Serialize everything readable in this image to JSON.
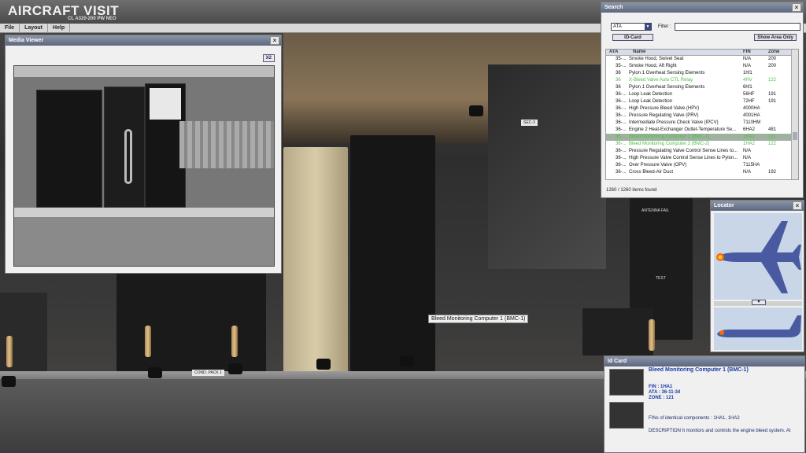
{
  "app": {
    "title": "AIRCRAFT VISIT",
    "subtitle": "CL A320-200 PW NEO"
  },
  "menu": [
    "File",
    "Layout",
    "Help"
  ],
  "scene": {
    "tooltip": "Bleed Monitoring Computer 1 (BMC-1)",
    "labels": {
      "antenna_fail": "ANTENNA FAIL",
      "test": "TEST",
      "cont_pack": "COND. PACK 1",
      "sec": "SEC-3"
    }
  },
  "media_viewer": {
    "title": "Media Viewer",
    "close": "×",
    "x2": "X2"
  },
  "search": {
    "title": "Search",
    "close": "×",
    "category": "ATA",
    "category_arrow": "▼",
    "filter_label": "Filter :",
    "filter_value": "",
    "idcard_button": "ID-Card",
    "show_area_button": "Show Area Only",
    "columns": {
      "ata": "ATA",
      "name": "Name",
      "fin": "FIN",
      "zone": "Zone"
    },
    "rows": [
      {
        "ata": "35-...",
        "name": "Smoke Hood, Swivel Seat",
        "fin": "N/A",
        "zone": "200",
        "style": ""
      },
      {
        "ata": "35-...",
        "name": "Smoke Hood, Aft Right",
        "fin": "N/A",
        "zone": "200",
        "style": ""
      },
      {
        "ata": "36",
        "name": "Pylon 1 Overheat Sensing Elements",
        "fin": "1hf1",
        "zone": "",
        "style": ""
      },
      {
        "ata": "36",
        "name": "X-Bleed Valve Auto CTL Relay",
        "fin": "4HV",
        "zone": "122",
        "style": "green"
      },
      {
        "ata": "36",
        "name": "Pylon 1 Overheat Sensing Elements",
        "fin": "6hf1",
        "zone": "",
        "style": ""
      },
      {
        "ata": "36-...",
        "name": "Loop Leak Detection",
        "fin": "56HF",
        "zone": "191",
        "style": ""
      },
      {
        "ata": "36-...",
        "name": "Loop Leak Detection",
        "fin": "72HF",
        "zone": "191",
        "style": ""
      },
      {
        "ata": "36-...",
        "name": "High Pressure Bleed Valve (HPV)",
        "fin": "4000HA",
        "zone": "",
        "style": ""
      },
      {
        "ata": "36-...",
        "name": "Pressure Regulating Valve (PRV)",
        "fin": "4001HA",
        "zone": "",
        "style": ""
      },
      {
        "ata": "36-...",
        "name": "Intermediate Pressure Check Valve (IPCV)",
        "fin": "7110HM",
        "zone": "",
        "style": ""
      },
      {
        "ata": "36-...",
        "name": "Engine 2 Heat-Exchanger Outlet-Temperature Se...",
        "fin": "6HA2",
        "zone": "481",
        "style": ""
      },
      {
        "ata": "36-...",
        "name": "Bleed Monitoring Computer 1 (BMC-1)",
        "fin": "1HA1",
        "zone": "121",
        "style": "green sel"
      },
      {
        "ata": "36-...",
        "name": "Bleed Monitoring Computer 2 (BMC-2)",
        "fin": "1HA2",
        "zone": "122",
        "style": "green"
      },
      {
        "ata": "36-...",
        "name": "Pressure Regulating Valve Control Sense Lines to...",
        "fin": "N/A",
        "zone": "",
        "style": ""
      },
      {
        "ata": "36-...",
        "name": "High Pressure Valve Control Sense Lines to Pylon...",
        "fin": "N/A",
        "zone": "",
        "style": ""
      },
      {
        "ata": "36-...",
        "name": "Over Pressure Valve (OPV)",
        "fin": "7115HA",
        "zone": "",
        "style": ""
      },
      {
        "ata": "36-...",
        "name": "Cross Bleed-Air Duct",
        "fin": "N/A",
        "zone": "192",
        "style": ""
      }
    ],
    "items_found": "1260 / 1260 items found"
  },
  "locator": {
    "title": "Locator",
    "close": "×",
    "toggle": "▼"
  },
  "id_card": {
    "title": "Id Card",
    "component_name": "Bleed Monitoring Computer 1 (BMC-1)",
    "fin": "FIN : 1HA1",
    "ata": "ATA : 36-11-34",
    "zone": "ZONE : 121",
    "identical": "FINs of identical components : 1HA1, 1HA2",
    "description": "DESCRIPTION It monitors and controls the engine bleed system. At"
  },
  "colors": {
    "panel_title": "#5c6680",
    "highlight_green": "#4bbf44",
    "selection": "#9fb2a0",
    "idcard_text": "#1a3aa0"
  }
}
